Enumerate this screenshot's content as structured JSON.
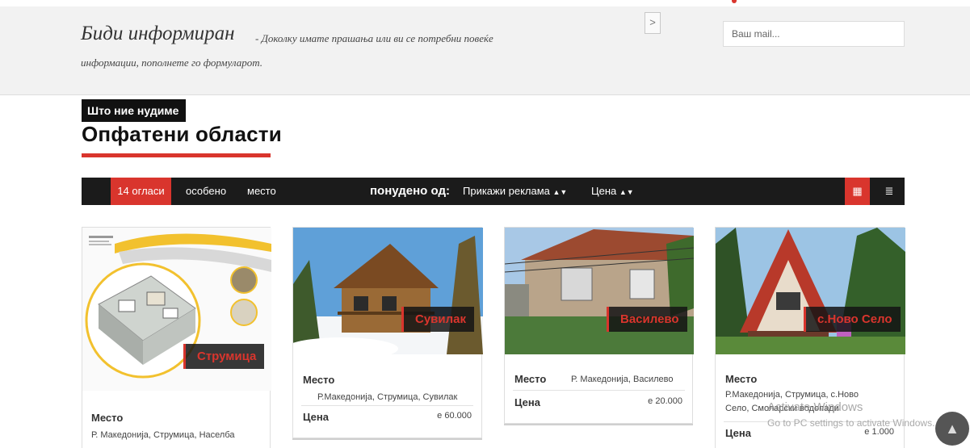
{
  "info": {
    "title": "Биди информиран",
    "subtitle_line1": "- Доколку имате прашања или ви се потребни повеќе",
    "subtitle_line2": "информации, пополнете го формуларот.",
    "next_arrow": ">",
    "mail_placeholder": "Ваш mail..."
  },
  "section": {
    "tag": "Што ние нудиме",
    "title": "Опфатени области"
  },
  "filter_bar": {
    "count": "14 огласи",
    "special": "особено",
    "place": "место",
    "offered_by": "понудено од:",
    "show_ads": "Прикажи реклама",
    "price": "Цена",
    "sort_glyph": "▲▼",
    "grid_icon": "▦",
    "list_icon": "≣"
  },
  "cards": [
    {
      "city": "Струмица",
      "place_label": "Место",
      "place_value": "Р. Македонија, Струмица, Населба",
      "price_label": "",
      "price_value": ""
    },
    {
      "city": "Сувилак",
      "place_label": "Место",
      "place_value": "Р.Македонија, Струмица, Сувилак",
      "price_label": "Цена",
      "price_value": "е 60.000"
    },
    {
      "city": "Василево",
      "place_label": "Место",
      "place_value": "Р. Македонија, Василево",
      "price_label": "Цена",
      "price_value": "е 20.000"
    },
    {
      "city": "с.Ново Село",
      "place_label": "Место",
      "place_value": "Р.Македонија, Струмица, с.Ново Село, Смоларски водопади",
      "price_label": "Цена",
      "price_value": "е 1.000"
    }
  ],
  "watermark": {
    "line1": "Activate Windows",
    "line2": "Go to PC settings to activate Windows."
  },
  "scroll_top": "▲",
  "colors": {
    "accent": "#d9352d",
    "bar": "#1b1b1b"
  }
}
